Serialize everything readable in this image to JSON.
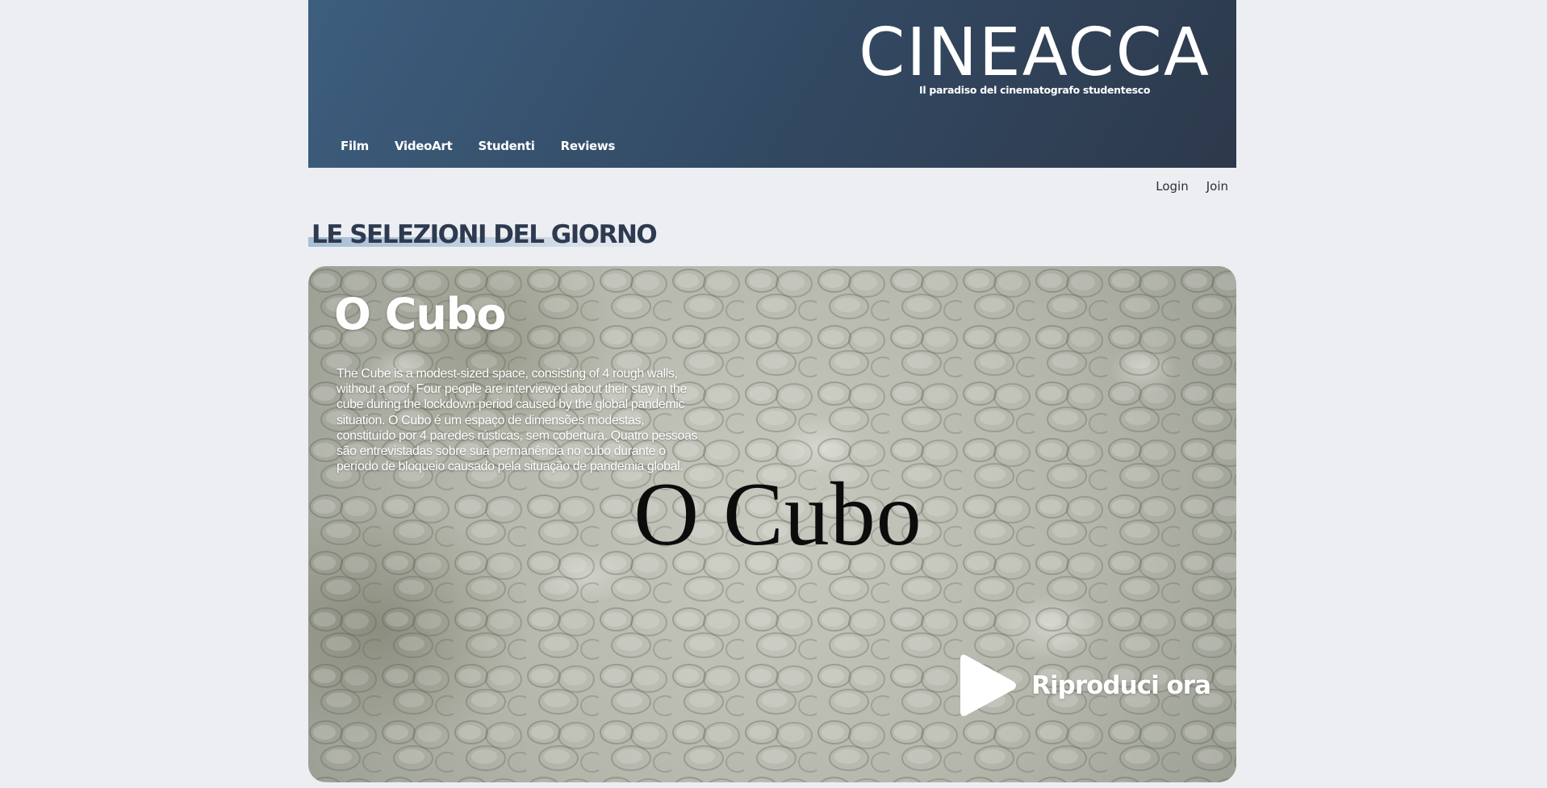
{
  "brand": {
    "title": "CINEACCA",
    "tagline": "Il paradiso del cinematografo studentesco"
  },
  "nav": {
    "items": [
      {
        "label": "Film"
      },
      {
        "label": "VideoArt"
      },
      {
        "label": "Studenti"
      },
      {
        "label": "Reviews"
      }
    ]
  },
  "auth": {
    "login_label": "Login",
    "join_label": "Join"
  },
  "section": {
    "title": "LE SELEZIONI DEL GIORNO"
  },
  "featured": {
    "title": "O Cubo",
    "description": "The Cube is a modest-sized space, consisting of 4 rough walls, without a roof. Four people are interviewed about their stay in the cube during the lockdown period caused by the global pandemic situation. O Cubo é um espaço de dimensões modestas, constituído por 4 paredes rústicas, sem cobertura. Quatro pessoas são entrevistadas sobre sua permanência no cubo durante o período de bloqueio causado pela situação de pandemia global.",
    "poster_text": "O Cubo",
    "play_label": "Riproduci ora",
    "play_icon": "play-icon"
  },
  "colors": {
    "header_start": "#3d5e7e",
    "header_end": "#2d394b",
    "page_background": "#eceef2",
    "section_title": "#2d3a4f",
    "title_underline": "#a8bfd6"
  }
}
